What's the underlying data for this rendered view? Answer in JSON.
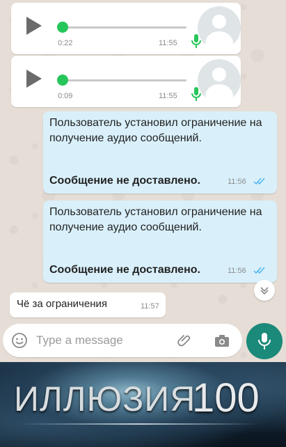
{
  "colors": {
    "accent": "#27c65a",
    "send_button": "#1b8a7a",
    "outgoing_bubble": "#d9f0fb",
    "read_ticks": "#4fb6ec"
  },
  "voice_messages": [
    {
      "duration": "0:22",
      "time": "11:55"
    },
    {
      "duration": "0:09",
      "time": "11:55"
    }
  ],
  "outgoing_messages": [
    {
      "text": "Пользователь установил ограничение на получение аудио сообщений.",
      "status": "Сообщение не доставлено.",
      "time": "11:56"
    },
    {
      "text": "Пользователь установил ограничение на получение аудио сообщений.",
      "status": "Сообщение не доставлено.",
      "time": "11:56"
    }
  ],
  "incoming_reply": {
    "text": "Чё за ограничения",
    "time": "11:57"
  },
  "composer": {
    "placeholder": "Type a message"
  },
  "icons": [
    "play-icon",
    "microphone-icon",
    "double-check-icon",
    "chevron-down-icon",
    "emoji-icon",
    "attach-icon",
    "camera-icon"
  ],
  "banner": {
    "word": "ИЛЛЮЗИЯ",
    "number": "100"
  }
}
